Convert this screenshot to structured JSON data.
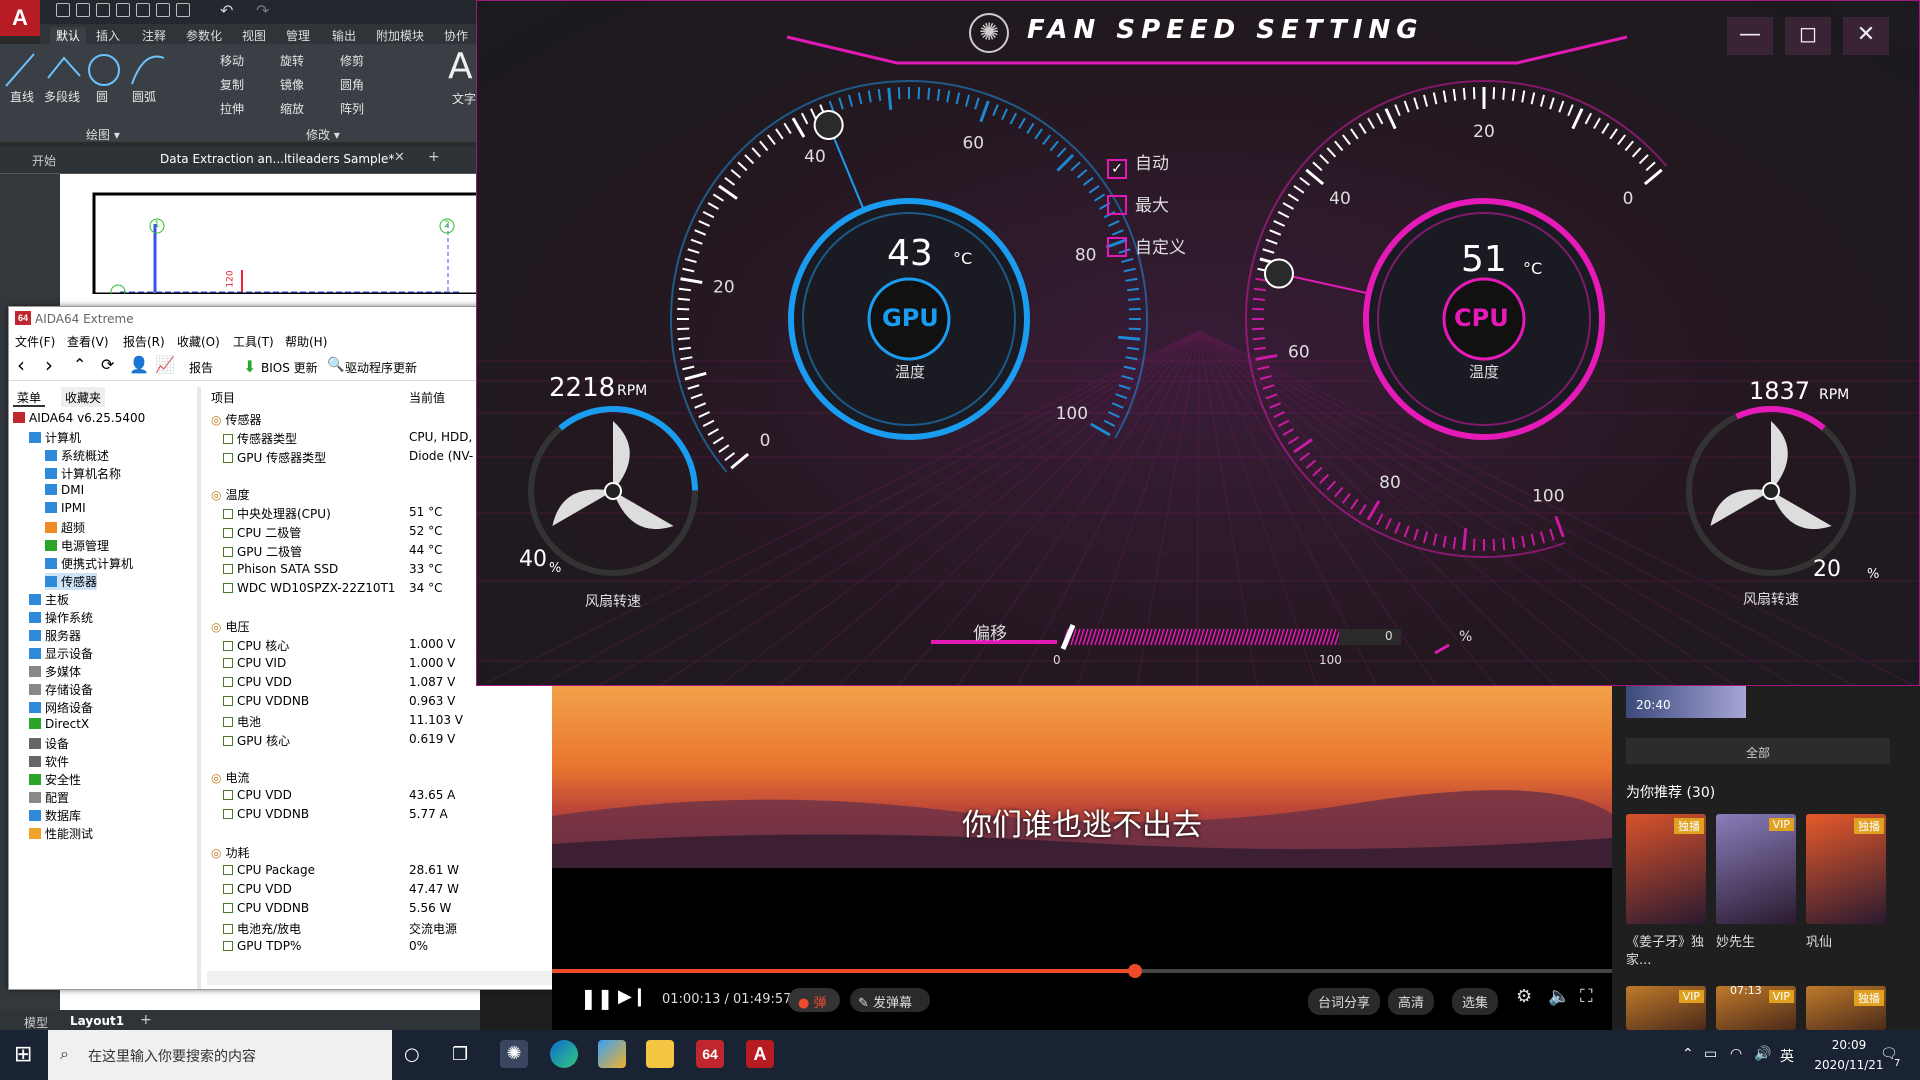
{
  "cad": {
    "logo": "A",
    "ribbon_tabs": [
      "默认",
      "插入",
      "注释",
      "参数化",
      "视图",
      "管理",
      "输出",
      "附加模块",
      "协作"
    ],
    "draw_tools": [
      "直线",
      "多段线",
      "圆",
      "圆弧"
    ],
    "modify_tools": [
      "移动",
      "旋转",
      "修剪",
      "复制",
      "镜像",
      "圆角",
      "拉伸",
      "缩放",
      "阵列"
    ],
    "text_tool": "文字",
    "group_draw": "绘图 ▾",
    "group_modify": "修改 ▾",
    "tab_start": "开始",
    "doc_tab": "Data Extraction an...ltileaders Sample*",
    "layout_model": "模型",
    "layout_1": "Layout1",
    "dim_120": "120",
    "marker_1": "1",
    "marker_2": "2"
  },
  "aida": {
    "title": "AIDA64 Extreme",
    "icon_text": "64",
    "menu": [
      "文件(F)",
      "查看(V)",
      "报告(R)",
      "收藏(O)",
      "工具(T)",
      "帮助(H)"
    ],
    "toolbar": {
      "report": "报告",
      "bios": "BIOS 更新",
      "driver": "驱动程序更新"
    },
    "left_tabs": [
      "菜单",
      "收藏夹"
    ],
    "tree": {
      "root": "AIDA64 v6.25.5400",
      "computer": "计算机",
      "computer_children": [
        "系统概述",
        "计算机名称",
        "DMI",
        "IPMI",
        "超频",
        "电源管理",
        "便携式计算机",
        "传感器"
      ],
      "others": [
        "主板",
        "操作系统",
        "服务器",
        "显示设备",
        "多媒体",
        "存储设备",
        "网络设备",
        "DirectX",
        "设备",
        "软件",
        "安全性",
        "配置",
        "数据库",
        "性能测试"
      ]
    },
    "col_item": "项目",
    "col_value": "当前值",
    "sections": [
      {
        "title": "传感器",
        "rows": [
          [
            "传感器类型",
            "CPU, HDD, A"
          ],
          [
            "GPU 传感器类型",
            "Diode (NV-"
          ]
        ]
      },
      {
        "title": "温度",
        "rows": [
          [
            "中央处理器(CPU)",
            "51 °C"
          ],
          [
            "CPU 二极管",
            "52 °C"
          ],
          [
            "GPU 二极管",
            "44 °C"
          ],
          [
            "Phison SATA SSD",
            "33 °C"
          ],
          [
            "WDC WD10SPZX-22Z10T1",
            "34 °C"
          ]
        ]
      },
      {
        "title": "电压",
        "rows": [
          [
            "CPU 核心",
            "1.000 V"
          ],
          [
            "CPU VID",
            "1.000 V"
          ],
          [
            "CPU VDD",
            "1.087 V"
          ],
          [
            "CPU VDDNB",
            "0.963 V"
          ],
          [
            "电池",
            "11.103 V"
          ],
          [
            "GPU 核心",
            "0.619 V"
          ]
        ]
      },
      {
        "title": "电流",
        "rows": [
          [
            "CPU VDD",
            "43.65 A"
          ],
          [
            "CPU VDDNB",
            "5.77 A"
          ]
        ]
      },
      {
        "title": "功耗",
        "rows": [
          [
            "CPU Package",
            "28.61 W"
          ],
          [
            "CPU VDD",
            "47.47 W"
          ],
          [
            "CPU VDDNB",
            "5.56 W"
          ],
          [
            "电池充/放电",
            "交流电源"
          ],
          [
            "GPU TDP%",
            "0%"
          ]
        ]
      }
    ]
  },
  "fan": {
    "title": "FAN SPEED SETTING",
    "gpu": {
      "temp": "43",
      "unit": "°C",
      "label": "GPU",
      "sub": "温度",
      "rpm": "2218",
      "rpm_unit": "RPM",
      "pct": "40",
      "pct_unit": "%",
      "fan_label": "风扇转速",
      "ticks": [
        "0",
        "20",
        "40",
        "60",
        "80",
        "100"
      ],
      "temp_value": 43,
      "fan_value": 40
    },
    "cpu": {
      "temp": "51",
      "unit": "°C",
      "label": "CPU",
      "sub": "温度",
      "rpm": "1837",
      "rpm_unit": "RPM",
      "pct": "20",
      "pct_unit": "%",
      "fan_label": "风扇转速",
      "ticks": [
        "0",
        "20",
        "40",
        "60",
        "80",
        "100"
      ],
      "temp_value": 51,
      "fan_value": 20
    },
    "modes": [
      {
        "label": "自动",
        "checked": true
      },
      {
        "label": "最大",
        "checked": false
      },
      {
        "label": "自定义",
        "checked": false
      }
    ],
    "offset": {
      "label": "偏移",
      "value": "0",
      "unit": "%",
      "min": "0",
      "max": "100",
      "value_num": 0
    },
    "colors": {
      "gpu": "#1a9cf0",
      "cpu": "#e61ab8",
      "border": "#a01a7d"
    }
  },
  "video": {
    "subtitle": "你们谁也逃不出去",
    "time": "01:00:13 / 01:49:57",
    "progress": 0.55,
    "danmaku": "弹",
    "send_danmaku": "发弹幕",
    "lyrics_share": "台词分享",
    "quality": "高清",
    "episodes": "选集",
    "side": {
      "thumb_time": "20:40",
      "all": "全部",
      "rec_title": "为你推荐 (30)",
      "items": [
        {
          "title": "《姜子牙》独家...",
          "badge": "独播",
          "color": "#d9522b"
        },
        {
          "title": "妙先生",
          "badge": "VIP",
          "color": "#8a7dba"
        },
        {
          "title": "巩仙",
          "badge": "独播",
          "color": "#e65a2a"
        }
      ],
      "row2_badges": [
        "VIP",
        "VIP",
        "独播"
      ],
      "row2_time": "07:13"
    }
  },
  "taskbar": {
    "search": "在这里输入你要搜索的内容",
    "ime": "英",
    "time": "20:09",
    "date": "2020/11/21",
    "notif": "7",
    "aida_badge": "64",
    "cad_badge": "A"
  }
}
